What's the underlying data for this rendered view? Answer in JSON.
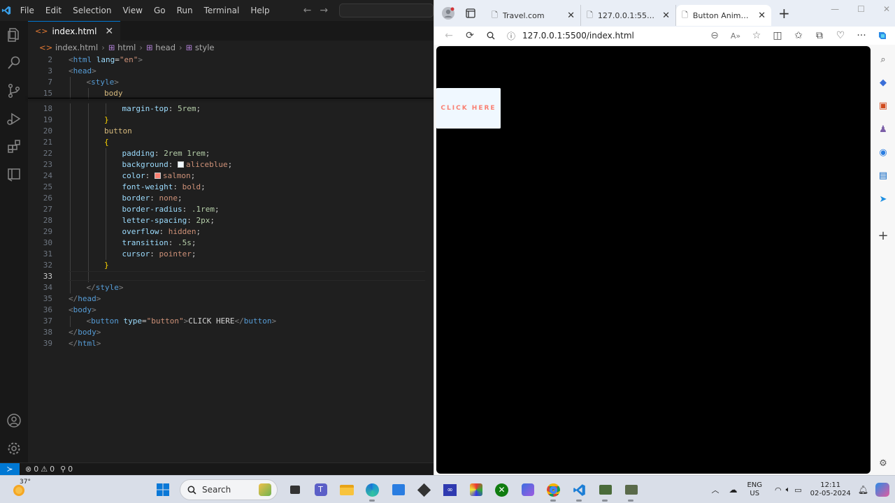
{
  "vscode": {
    "menu": [
      "File",
      "Edit",
      "Selection",
      "View",
      "Go",
      "Run",
      "Terminal",
      "Help"
    ],
    "tab": {
      "filename": "index.html"
    },
    "breadcrumbs": [
      "index.html",
      "html",
      "head",
      "style"
    ],
    "code_lines": [
      {
        "n": "2",
        "tokens": [
          [
            "t-br",
            "<"
          ],
          [
            "t-tag",
            "html"
          ],
          [
            "t-text",
            " "
          ],
          [
            "t-attr",
            "lang"
          ],
          [
            "t-punc",
            "="
          ],
          [
            "t-str",
            "\"en\""
          ],
          [
            "t-br",
            ">"
          ]
        ],
        "indent": 0
      },
      {
        "n": "3",
        "tokens": [
          [
            "t-br",
            "<"
          ],
          [
            "t-tag",
            "head"
          ],
          [
            "t-br",
            ">"
          ]
        ],
        "indent": 0
      },
      {
        "n": "7",
        "tokens": [
          [
            "t-br",
            "<"
          ],
          [
            "t-tag",
            "style"
          ],
          [
            "t-br",
            ">"
          ]
        ],
        "indent": 1
      },
      {
        "n": "15",
        "tokens": [
          [
            "t-sel",
            "body"
          ]
        ],
        "indent": 2
      },
      {
        "n": "18",
        "tokens": [
          [
            "t-prop",
            "margin-top"
          ],
          [
            "t-punc",
            ": "
          ],
          [
            "t-num",
            "5rem"
          ],
          [
            "t-punc",
            ";"
          ]
        ],
        "indent": 3
      },
      {
        "n": "19",
        "tokens": [
          [
            "t-brace",
            "}"
          ]
        ],
        "indent": 2
      },
      {
        "n": "20",
        "tokens": [
          [
            "t-sel",
            "button"
          ]
        ],
        "indent": 2
      },
      {
        "n": "21",
        "tokens": [
          [
            "t-brace",
            "{"
          ]
        ],
        "indent": 2
      },
      {
        "n": "22",
        "tokens": [
          [
            "t-prop",
            "padding"
          ],
          [
            "t-punc",
            ": "
          ],
          [
            "t-num",
            "2rem 1rem"
          ],
          [
            "t-punc",
            ";"
          ]
        ],
        "indent": 3
      },
      {
        "n": "23",
        "tokens": [
          [
            "t-prop",
            "background"
          ],
          [
            "t-punc",
            ": "
          ],
          [
            "swatch",
            "#f0f8ff"
          ],
          [
            "t-val",
            "aliceblue"
          ],
          [
            "t-punc",
            ";"
          ]
        ],
        "indent": 3
      },
      {
        "n": "24",
        "tokens": [
          [
            "t-prop",
            "color"
          ],
          [
            "t-punc",
            ": "
          ],
          [
            "swatch",
            "#fa8072"
          ],
          [
            "t-val",
            "salmon"
          ],
          [
            "t-punc",
            ";"
          ]
        ],
        "indent": 3
      },
      {
        "n": "25",
        "tokens": [
          [
            "t-prop",
            "font-weight"
          ],
          [
            "t-punc",
            ": "
          ],
          [
            "t-val",
            "bold"
          ],
          [
            "t-punc",
            ";"
          ]
        ],
        "indent": 3
      },
      {
        "n": "26",
        "tokens": [
          [
            "t-prop",
            "border"
          ],
          [
            "t-punc",
            ": "
          ],
          [
            "t-val",
            "none"
          ],
          [
            "t-punc",
            ";"
          ]
        ],
        "indent": 3
      },
      {
        "n": "27",
        "tokens": [
          [
            "t-prop",
            "border-radius"
          ],
          [
            "t-punc",
            ": "
          ],
          [
            "t-num",
            ".1rem"
          ],
          [
            "t-punc",
            ";"
          ]
        ],
        "indent": 3
      },
      {
        "n": "28",
        "tokens": [
          [
            "t-prop",
            "letter-spacing"
          ],
          [
            "t-punc",
            ": "
          ],
          [
            "t-num",
            "2px"
          ],
          [
            "t-punc",
            ";"
          ]
        ],
        "indent": 3
      },
      {
        "n": "29",
        "tokens": [
          [
            "t-prop",
            "overflow"
          ],
          [
            "t-punc",
            ": "
          ],
          [
            "t-val",
            "hidden"
          ],
          [
            "t-punc",
            ";"
          ]
        ],
        "indent": 3
      },
      {
        "n": "30",
        "tokens": [
          [
            "t-prop",
            "transition"
          ],
          [
            "t-punc",
            ": "
          ],
          [
            "t-num",
            ".5s"
          ],
          [
            "t-punc",
            ";"
          ]
        ],
        "indent": 3
      },
      {
        "n": "31",
        "tokens": [
          [
            "t-prop",
            "cursor"
          ],
          [
            "t-punc",
            ": "
          ],
          [
            "t-val",
            "pointer"
          ],
          [
            "t-punc",
            ";"
          ]
        ],
        "indent": 3
      },
      {
        "n": "32",
        "tokens": [
          [
            "t-brace",
            "}"
          ]
        ],
        "indent": 2
      },
      {
        "n": "33",
        "tokens": [],
        "indent": 2,
        "current": true
      },
      {
        "n": "34",
        "tokens": [
          [
            "t-br",
            "</"
          ],
          [
            "t-tag",
            "style"
          ],
          [
            "t-br",
            ">"
          ]
        ],
        "indent": 1
      },
      {
        "n": "35",
        "tokens": [
          [
            "t-br",
            "</"
          ],
          [
            "t-tag",
            "head"
          ],
          [
            "t-br",
            ">"
          ]
        ],
        "indent": 0
      },
      {
        "n": "36",
        "tokens": [
          [
            "t-br",
            "<"
          ],
          [
            "t-tag",
            "body"
          ],
          [
            "t-br",
            ">"
          ]
        ],
        "indent": 0
      },
      {
        "n": "37",
        "tokens": [
          [
            "t-br",
            "<"
          ],
          [
            "t-tag",
            "button"
          ],
          [
            "t-text",
            " "
          ],
          [
            "t-attr",
            "type"
          ],
          [
            "t-punc",
            "="
          ],
          [
            "t-str",
            "\"button\""
          ],
          [
            "t-br",
            ">"
          ],
          [
            "t-text",
            "CLICK HERE"
          ],
          [
            "t-br",
            "</"
          ],
          [
            "t-tag",
            "button"
          ],
          [
            "t-br",
            ">"
          ]
        ],
        "indent": 1
      },
      {
        "n": "38",
        "tokens": [
          [
            "t-br",
            "</"
          ],
          [
            "t-tag",
            "body"
          ],
          [
            "t-br",
            ">"
          ]
        ],
        "indent": 0
      },
      {
        "n": "39",
        "tokens": [
          [
            "t-br",
            "</"
          ],
          [
            "t-tag",
            "html"
          ],
          [
            "t-br",
            ">"
          ]
        ],
        "indent": 0
      }
    ],
    "status": {
      "errors": "0",
      "warnings": "0",
      "ports": "0"
    }
  },
  "browser": {
    "tabs": [
      {
        "title": "Travel.com",
        "active": false
      },
      {
        "title": "127.0.0.1:5500/index.html",
        "active": false
      },
      {
        "title": "Button Animation",
        "active": true
      }
    ],
    "url": "127.0.0.1:5500/index.html",
    "page": {
      "button_label": "CLICK HERE",
      "background": "#000000",
      "button_bg": "#f0f8ff",
      "button_color": "#fa8072"
    }
  },
  "taskbar": {
    "temperature": "37°",
    "search_label": "Search",
    "lang": "ENG",
    "region": "US",
    "time": "12:11",
    "date": "02-05-2024"
  }
}
